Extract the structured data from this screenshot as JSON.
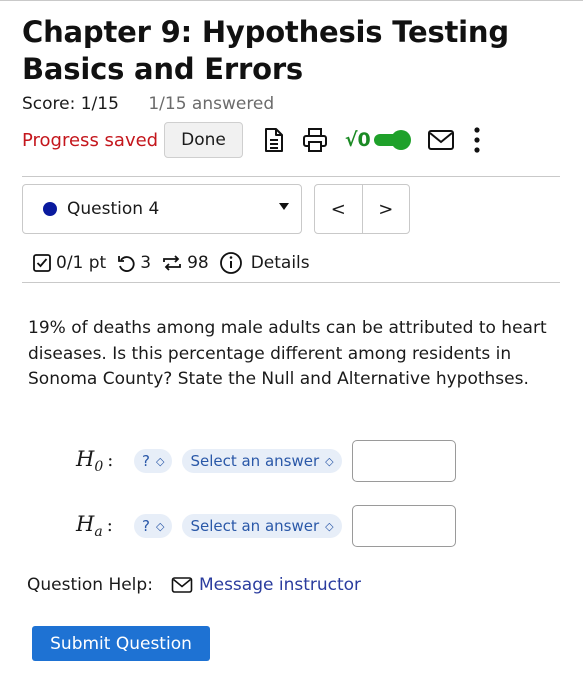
{
  "page": {
    "title_line1": "Chapter 9: Hypothesis Testing",
    "title_line2": "Basics and Errors",
    "score": "Score: 1/15",
    "answered": "1/15 answered",
    "progress_saved": "Progress saved",
    "done_label": "Done",
    "sqrt_label": "√0"
  },
  "toolbar_icons": [
    "document-icon",
    "print-icon",
    "math-toggle",
    "mail-icon",
    "more-vertical-icon"
  ],
  "question_nav": {
    "selected": "Question 4",
    "prev_symbol": "<",
    "next_symbol": ">"
  },
  "meta": {
    "points": "0/1 pt",
    "retries": "3",
    "attempts": "98",
    "details": "Details"
  },
  "question": {
    "text": "19% of deaths among male adults can be attributed to heart diseases. Is this percentage different among residents in Sonoma County? State the Null and Alternative hypothses.",
    "null_label": "H",
    "null_sub": "0",
    "alt_label": "H",
    "alt_sub": "a",
    "colon": ":",
    "symbol_placeholder": "?",
    "select_placeholder": "Select an answer"
  },
  "help": {
    "label": "Question Help:",
    "link": "Message instructor"
  },
  "submit_label": "Submit Question",
  "colors": {
    "accent": "#1e72d3",
    "saved_red": "#c4161c",
    "toggle_green": "#1fa12a",
    "question_dot": "#0a1a9e"
  }
}
